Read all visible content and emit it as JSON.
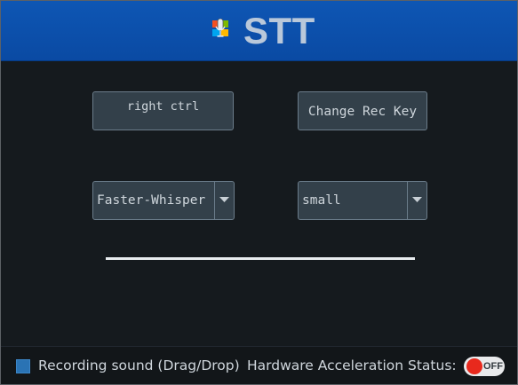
{
  "header": {
    "title": "STT",
    "logo_icon": "microphone-windows-logo-icon"
  },
  "controls": {
    "record_key_label": "right ctrl",
    "change_key_button_label": "Change Rec Key",
    "engine_select": {
      "value": "Faster-Whisper"
    },
    "model_select": {
      "value": "small"
    }
  },
  "status": {
    "recording_checkbox_label": "Recording sound (Drag/Drop)",
    "recording_checked": true,
    "accel_label": "Hardware Acceleration Status:",
    "accel_toggle_text": "OFF",
    "accel_on": false
  },
  "colors": {
    "header_blue": "#0a4aa3",
    "background": "#151a1e",
    "button_fill": "#33404a",
    "toggle_knob_off": "#e8291d",
    "checkbox_blue": "#2a73b4"
  }
}
